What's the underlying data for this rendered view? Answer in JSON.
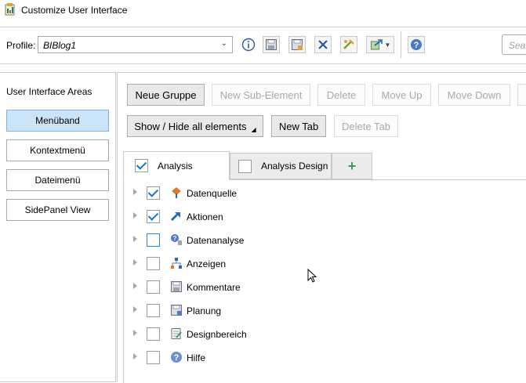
{
  "window": {
    "title": "Customize User Interface"
  },
  "toolbar": {
    "profile_label": "Profile:",
    "profile_value": "BIBlog1",
    "search_placeholder": "Sear",
    "icons": [
      "info-icon",
      "save-icon",
      "save-as-icon",
      "delete-x-icon",
      "import-icon",
      "export-dropdown-icon",
      "help-icon"
    ]
  },
  "left": {
    "title": "User Interface Areas",
    "areas": [
      {
        "label": "Menüband",
        "selected": true
      },
      {
        "label": "Kontextmenü",
        "selected": false
      },
      {
        "label": "Dateimenü",
        "selected": false
      },
      {
        "label": "SidePanel View",
        "selected": false
      }
    ]
  },
  "actions": {
    "neue_gruppe": "Neue Gruppe",
    "new_sub_element": "New Sub-Element",
    "delete": "Delete",
    "move_up": "Move Up",
    "move_down": "Move Down",
    "show_hide": "Show / Hide all elements",
    "new_tab": "New Tab",
    "delete_tab": "Delete Tab"
  },
  "tabs": [
    {
      "label": "Analysis",
      "checked": true,
      "active": true
    },
    {
      "label": "Analysis Design",
      "checked": false,
      "active": false
    },
    {
      "label": "+",
      "add": true
    }
  ],
  "tree": [
    {
      "label": "Datenquelle",
      "checked": true,
      "icon": "datasource-icon"
    },
    {
      "label": "Aktionen",
      "checked": true,
      "icon": "actions-icon"
    },
    {
      "label": "Datenanalyse",
      "checked": false,
      "icon": "data-analysis-icon"
    },
    {
      "label": "Anzeigen",
      "checked": false,
      "icon": "display-icon"
    },
    {
      "label": "Kommentare",
      "checked": false,
      "icon": "comments-icon"
    },
    {
      "label": "Planung",
      "checked": false,
      "icon": "planning-icon"
    },
    {
      "label": "Designbereich",
      "checked": false,
      "icon": "design-area-icon"
    },
    {
      "label": "Hilfe",
      "checked": false,
      "icon": "help-icon"
    }
  ],
  "colors": {
    "accent": "#1e74c6",
    "selected_bg": "#cce4f7",
    "add_tab": "#3a9a5a"
  }
}
